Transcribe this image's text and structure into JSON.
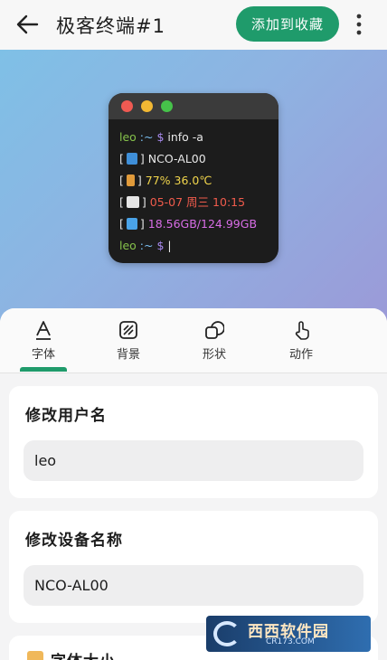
{
  "header": {
    "title": "极客终端#1",
    "fav_button": "添加到收藏"
  },
  "terminal": {
    "prompt_user": "leo",
    "prompt_sep": " :~ ",
    "prompt_sign": "$",
    "command": " info -a",
    "device": "NCO-AL00",
    "battery": "77% 36.0℃",
    "datetime": "05-07 周三 10:15",
    "storage": "18.56GB/124.99GB",
    "cursor": "|",
    "bracket_open": "[",
    "bracket_close": "]",
    "colors": {
      "prompt": "#86c24b",
      "battery": "#f1d54c",
      "datetime": "#f05b4c",
      "storage": "#d86de6"
    }
  },
  "tabs": [
    {
      "label": "字体",
      "icon": "font-icon",
      "active": true
    },
    {
      "label": "背景",
      "icon": "background-icon",
      "active": false
    },
    {
      "label": "形状",
      "icon": "shape-icon",
      "active": false
    },
    {
      "label": "动作",
      "icon": "touch-icon",
      "active": false
    }
  ],
  "username_card": {
    "title": "修改用户名",
    "value": "leo"
  },
  "device_card": {
    "title": "修改设备名称",
    "value": "NCO-AL00"
  },
  "font_size_card": {
    "title": "字体大小"
  },
  "watermark": {
    "name": "西西软件园",
    "url": "CR173.COM"
  },
  "accent_color": "#1f9b6b"
}
